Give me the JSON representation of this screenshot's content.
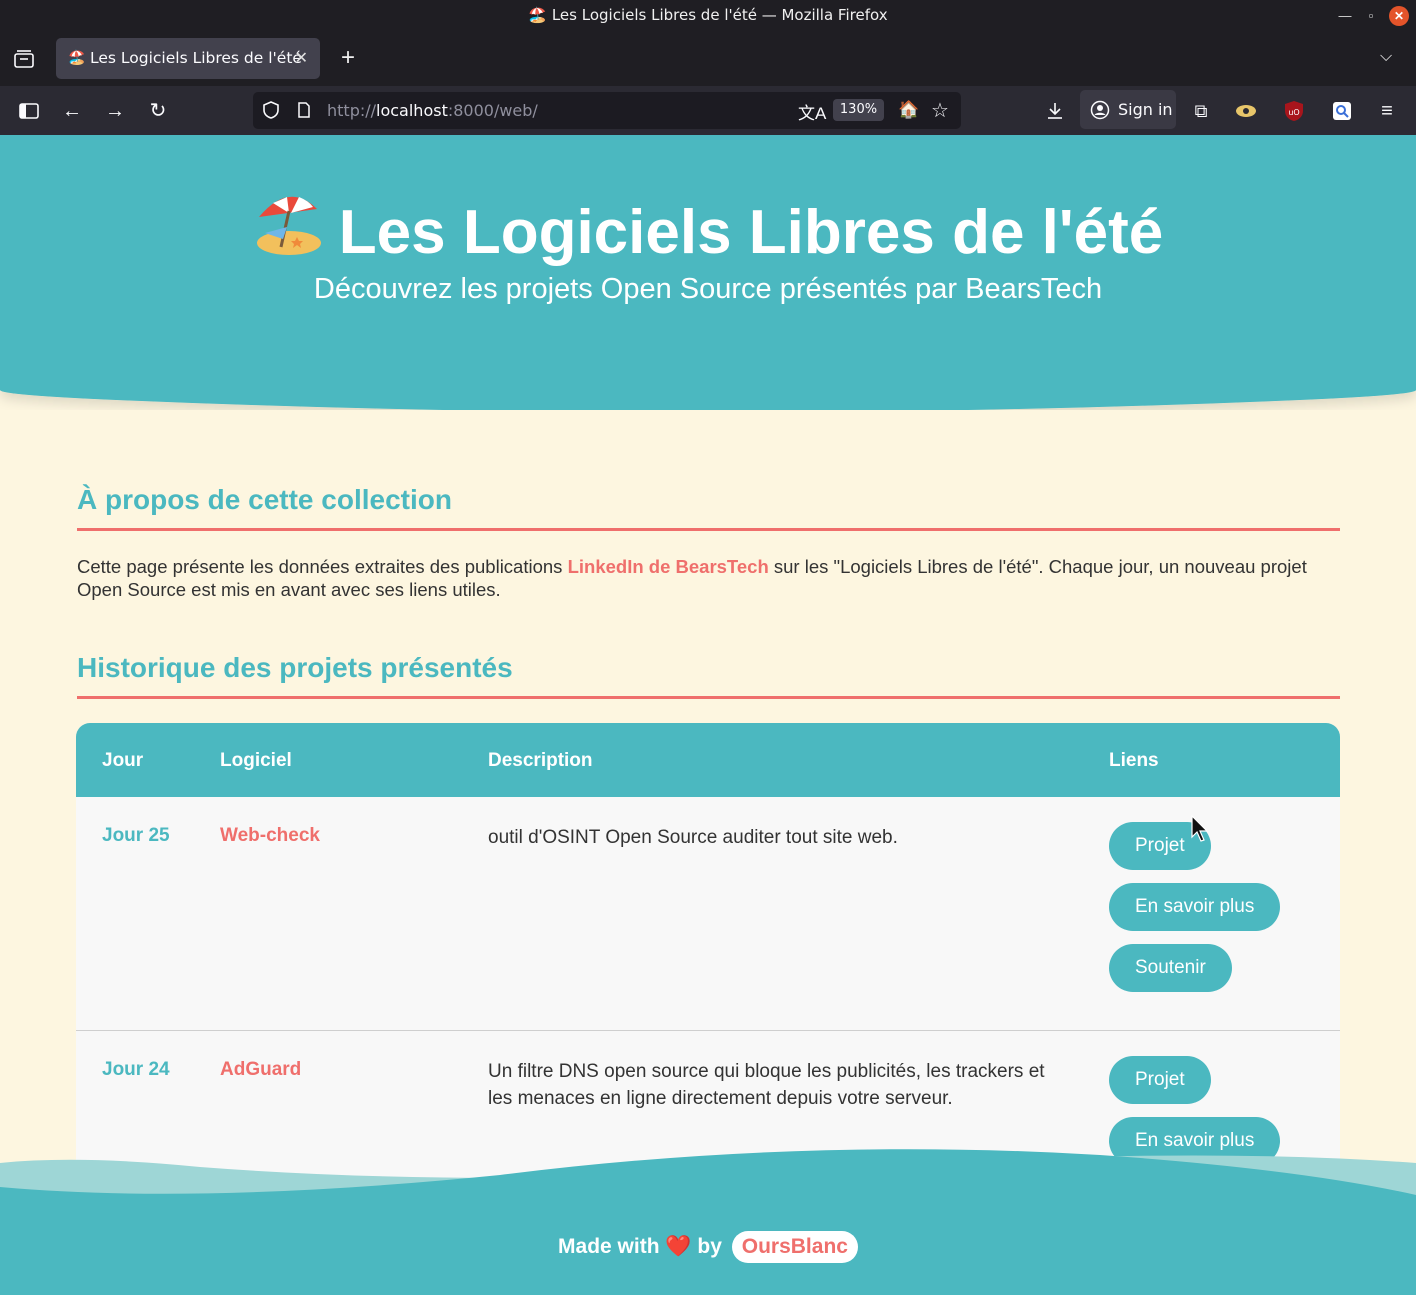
{
  "window": {
    "title": "Les Logiciels Libres de l'été — Mozilla Firefox"
  },
  "tab": {
    "label": "Les Logiciels Libres de l'été"
  },
  "urlbar": {
    "url_prefix": "http://",
    "url_host": "localhost",
    "url_rest": ":8000/web/",
    "zoom": "130%"
  },
  "toolbar": {
    "signin_label": "Sign in"
  },
  "hero": {
    "title": "Les Logiciels Libres de l'été",
    "subtitle": "Découvrez les projets Open Source présentés par BearsTech"
  },
  "about": {
    "heading": "À propos de cette collection",
    "text_before": "Cette page présente les données extraites des publications ",
    "link": "LinkedIn de BearsTech",
    "text_after": " sur les \"Logiciels Libres de l'été\". Chaque jour, un nouveau projet Open Source est mis en avant avec ses liens utiles."
  },
  "history": {
    "heading": "Historique des projets présentés",
    "columns": [
      "Jour",
      "Logiciel",
      "Description",
      "Liens"
    ],
    "rows": [
      {
        "day": "Jour 25",
        "software": "Web-check",
        "description": "outil d'OSINT Open Source auditer tout site web.",
        "links": [
          "Projet",
          "En savoir plus",
          "Soutenir"
        ]
      },
      {
        "day": "Jour 24",
        "software": "AdGuard",
        "description": "Un filtre DNS open source qui bloque les publicités, les trackers et les menaces en ligne directement depuis votre serveur.",
        "links": [
          "Projet",
          "En savoir plus"
        ]
      }
    ]
  },
  "footer": {
    "made_with": "Made with",
    "by": "by",
    "author": "OursBlanc"
  },
  "colors": {
    "teal": "#4bb8c0",
    "coral": "#ef6f6c",
    "cream": "#fdf6e0"
  }
}
